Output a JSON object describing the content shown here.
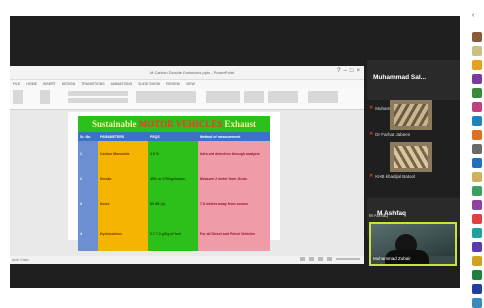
{
  "powerpoint": {
    "window_title": "M Carbon Dioxide Emissions.pptx - PowerPoint",
    "ribbon_tabs": [
      "FILE",
      "HOME",
      "INSERT",
      "DESIGN",
      "TRANSITIONS",
      "ANIMATIONS",
      "SLIDE SHOW",
      "REVIEW",
      "VIEW"
    ],
    "slide": {
      "title_part1": "Sustainable",
      "title_part2": "MOTOR VEHICLES",
      "title_part3": "Exhaust",
      "table": {
        "headers": [
          "Sr. No.",
          "PARAMETERS",
          "PEQS",
          "Method of measurement"
        ],
        "rows": [
          [
            "1",
            "Carbon Monoxide",
            "4.5 %",
            "Infra-red detection through analyzer"
          ],
          [
            "2",
            "Smoke",
            "40% or  2 Ringelmann",
            "Measure 2 meter from Jicsin"
          ],
          [
            "3",
            "Noise",
            "85 dB (A)",
            "7.5 meters away from source"
          ],
          [
            "4",
            "Hydrocarbon",
            "0.7 7.0 g/Kg of fuel",
            "For all Diesel and Petrol Vehicles"
          ]
        ]
      }
    },
    "status_left": "Audi Gokio"
  },
  "participants": {
    "featured_name": "Muhammad  Sal...",
    "featured_caption": "Muhammad Salman r...",
    "tile1_caption": "Dr Farhat Jabeen",
    "tile2_caption": "KHB khadijal Batool",
    "ashfaq_name": "M Ashfaq",
    "ashfaq_caption": "M Ashfaq",
    "zubair_caption": "Muhammad Zubair"
  },
  "sidebar": {
    "avatar_colors": [
      "#8a5a3a",
      "#ccc080",
      "#e6a020",
      "#7a3aa0",
      "#3a8a3a",
      "#c04080",
      "#2080c0",
      "#e07020",
      "#6a6a6a",
      "#2070c0",
      "#d0b060",
      "#3aa060",
      "#9040a0",
      "#e04040",
      "#20a0a0",
      "#5a3ab0",
      "#d0a020",
      "#208040",
      "#2040a0",
      "#3a8ac0"
    ]
  },
  "colors": {
    "slide_title_bg": "#2bc01a",
    "header_blue": "#3b72c6",
    "active_speaker_border": "#c8e33a"
  }
}
